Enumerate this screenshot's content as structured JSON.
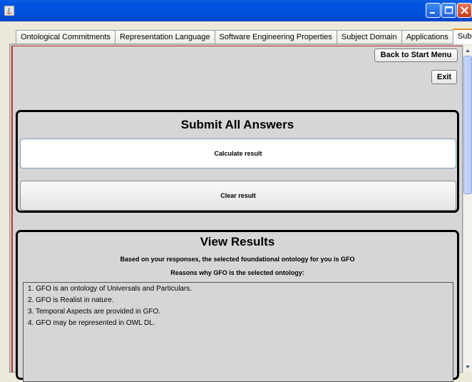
{
  "window": {
    "title": "",
    "colors": {
      "titlebar": "#0052DF",
      "close": "#C6391A",
      "panel_border": "#000000",
      "accent_border": "#C0392B"
    }
  },
  "tabs": [
    {
      "label": "Ontological Commitments",
      "active": false
    },
    {
      "label": "Representation Language",
      "active": false
    },
    {
      "label": "Software Engineering Properties",
      "active": false
    },
    {
      "label": "Subject Domain",
      "active": false
    },
    {
      "label": "Applications",
      "active": false
    },
    {
      "label": "Submit",
      "active": true
    }
  ],
  "toolbar": {
    "back_label": "Back to Start Menu",
    "exit_label": "Exit"
  },
  "submit_panel": {
    "title": "Submit All Answers",
    "calculate_label": "Calculate result",
    "clear_label": "Clear result"
  },
  "results_panel": {
    "title": "View Results",
    "summary": "Based on your responses, the selected foundational ontology for you is GFO",
    "reasons_heading": "Reasons why GFO is the selected ontology:",
    "reasons": [
      "1. GFO is an ontology of Universals and Particulars.",
      "2. GFO is Realist in nature.",
      "3. Temporal Aspects are provided in GFO.",
      "4. GFO may be represented in OWL DL."
    ]
  }
}
